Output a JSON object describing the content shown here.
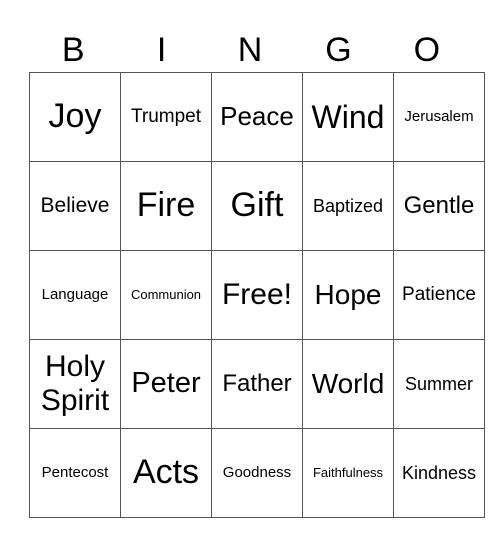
{
  "header": [
    "B",
    "I",
    "N",
    "G",
    "O"
  ],
  "cells": [
    [
      {
        "text": "Joy",
        "size": 34
      },
      {
        "text": "Trumpet",
        "size": 19
      },
      {
        "text": "Peace",
        "size": 26
      },
      {
        "text": "Wind",
        "size": 32
      },
      {
        "text": "Jerusalem",
        "size": 15
      }
    ],
    [
      {
        "text": "Believe",
        "size": 21
      },
      {
        "text": "Fire",
        "size": 34
      },
      {
        "text": "Gift",
        "size": 34
      },
      {
        "text": "Baptized",
        "size": 18
      },
      {
        "text": "Gentle",
        "size": 24
      }
    ],
    [
      {
        "text": "Language",
        "size": 15
      },
      {
        "text": "Communion",
        "size": 13
      },
      {
        "text": "Free!",
        "size": 30
      },
      {
        "text": "Hope",
        "size": 28
      },
      {
        "text": "Patience",
        "size": 19
      }
    ],
    [
      {
        "text": "Holy Spirit",
        "size": 30
      },
      {
        "text": "Peter",
        "size": 29
      },
      {
        "text": "Father",
        "size": 24
      },
      {
        "text": "World",
        "size": 28
      },
      {
        "text": "Summer",
        "size": 18
      }
    ],
    [
      {
        "text": "Pentecost",
        "size": 15
      },
      {
        "text": "Acts",
        "size": 34
      },
      {
        "text": "Goodness",
        "size": 15
      },
      {
        "text": "Faithfulness",
        "size": 13
      },
      {
        "text": "Kindness",
        "size": 18
      }
    ]
  ]
}
